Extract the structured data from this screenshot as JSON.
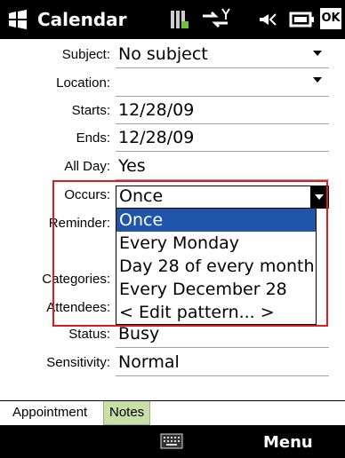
{
  "titlebar": {
    "app_title": "Calendar",
    "ok_label": "OK"
  },
  "form": {
    "subject": {
      "label": "Subject:",
      "value": "No subject"
    },
    "location": {
      "label": "Location:",
      "value": ""
    },
    "starts": {
      "label": "Starts:",
      "value": "12/28/09"
    },
    "ends": {
      "label": "Ends:",
      "value": "12/28/09"
    },
    "all_day": {
      "label": "All Day:",
      "value": "Yes"
    },
    "occurs": {
      "label": "Occurs:",
      "value": "Once"
    },
    "reminder": {
      "label": "Reminder:"
    },
    "categories": {
      "label": "Categories:"
    },
    "attendees": {
      "label": "Attendees:"
    },
    "status": {
      "label": "Status:",
      "value": "Busy"
    },
    "sensitivity": {
      "label": "Sensitivity:",
      "value": "Normal"
    }
  },
  "occurs_dropdown": {
    "options": [
      "Once",
      "Every Monday",
      "Day 28 of every month",
      "Every December 28",
      "< Edit pattern... >"
    ],
    "selected_index": 0
  },
  "tabs": [
    "Appointment",
    "Notes"
  ],
  "menubar": {
    "menu_label": "Menu"
  },
  "colors": {
    "selection": "#1f56a9",
    "highlight_box": "#e01a1a",
    "notes_tab": "#c9dfa9"
  }
}
